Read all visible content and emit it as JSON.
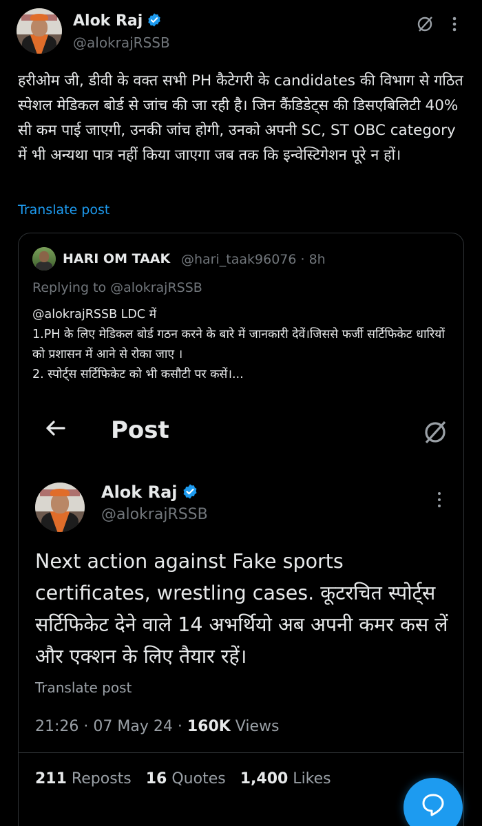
{
  "author": {
    "name": "Alok Raj",
    "handle": "@alokrajRSSB"
  },
  "post": {
    "text": "हरीओम जी, डीवी के वक्त सभी PH कैटेगरी के candidates की विभाग से गठित स्पेशल मेडिकल बोर्ड से जांच की जा रही है। जिन कैंडिडेट्स की डिसएबिलिटी 40% सी कम पाई जाएगी, उनकी जांच होगी, उनको अपनी SC, ST OBC category में भी अन्यथा पात्र नहीं किया जाएगा जब तक कि इन्वेस्टिगेशन पूरे न हों।",
    "translate_label": "Translate post"
  },
  "quote": {
    "name": "HARI OM TAAK",
    "handle_time": "@hari_taak96076 · 8h",
    "replying_to": "Replying to @alokrajRSSB",
    "text_line1": "@alokrajRSSB LDC में",
    "text_line2": "1.PH के लिए मेडिकल बोर्ड गठन करने के बारे में जानकारी देवें।जिससे फर्जी सर्टिफिकेट धारियों को प्रशासन में आने से रोका जाए ।",
    "text_line3": "2. स्पोर्ट्स सर्टिफिकेट को भी कसौटी पर कसें।..."
  },
  "inner": {
    "title": "Post",
    "name": "Alok Raj",
    "handle": "@alokrajRSSB",
    "text": "Next action against Fake sports certificates, wrestling cases. कूटरचित स्पोर्ट्स सर्टिफिकेट देने वाले 14 अभर्थियो अब अपनी कमर कस लें और एक्शन के लिए तैयार रहें।",
    "translate_label": "Translate post",
    "time": "21:26 · 07 May 24 · ",
    "views_count": "160K",
    "views_label": " Views",
    "reposts_count": "211",
    "reposts_label": " Reposts",
    "quotes_count": "16",
    "quotes_label": " Quotes",
    "likes_count": "1,400",
    "likes_label": " Likes"
  },
  "colors": {
    "accent": "#1d9bf0",
    "muted": "#71767b",
    "text": "#e7e9ea",
    "border": "#2f3336"
  }
}
